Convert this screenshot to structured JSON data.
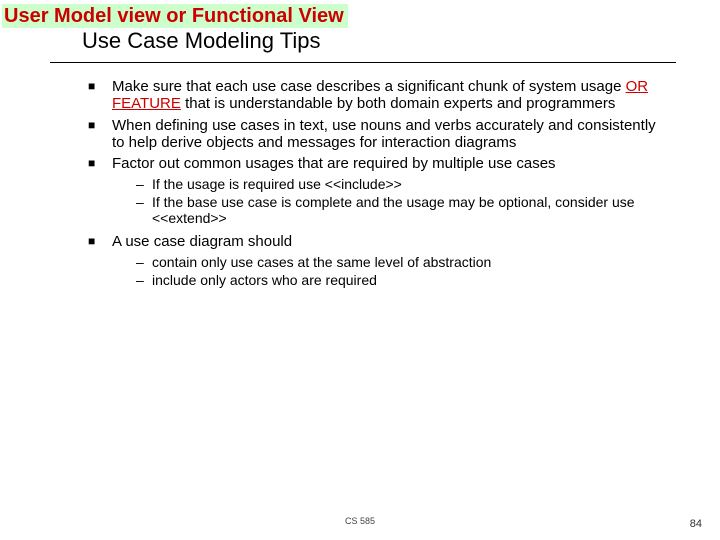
{
  "banner": "User Model view or Functional View",
  "subtitle": "Use Case Modeling Tips",
  "bullets": [
    {
      "pre": "Make sure that each use case describes a significant chunk of system usage ",
      "hl": "OR FEATURE",
      "post": " that is understandable by both domain experts and programmers"
    },
    {
      "pre": "When defining use cases in text, use nouns and verbs accurately and consistently to help derive objects and messages for interaction diagrams",
      "hl": "",
      "post": ""
    },
    {
      "pre": "Factor out common usages that are required by multiple use cases",
      "hl": "",
      "post": "",
      "sub": [
        "If the usage is required use <<include>>",
        "If the base use case is complete and the usage may be optional, consider use <<extend>>"
      ]
    },
    {
      "pre": "A use case diagram should",
      "hl": "",
      "post": "",
      "sub": [
        "contain only use cases at the same level of abstraction",
        "include only actors who are required"
      ]
    }
  ],
  "footer": {
    "course": "CS 585",
    "page": "84"
  }
}
